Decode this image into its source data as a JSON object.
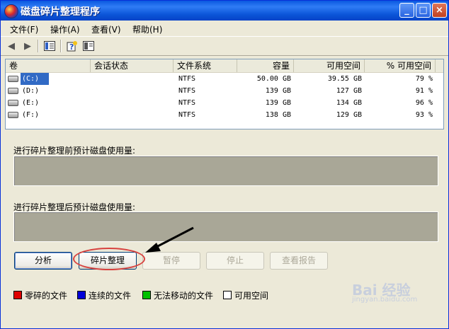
{
  "window": {
    "title": "磁盘碎片整理程序",
    "buttons": {
      "minimize": "_",
      "maximize": "□",
      "close": "×"
    }
  },
  "menu": {
    "items": [
      "文件(F)",
      "操作(A)",
      "查看(V)",
      "帮助(H)"
    ]
  },
  "toolbar": {
    "icons": [
      "back-arrow-icon",
      "forward-arrow-icon",
      "view-icon",
      "help-icon",
      "console-icon"
    ]
  },
  "volumes": {
    "columns": [
      "卷",
      "会话状态",
      "文件系统",
      "容量",
      "可用空间",
      "% 可用空间"
    ],
    "rows": [
      {
        "volume": "(C:)",
        "status": "",
        "fs": "NTFS",
        "capacity": "50.00 GB",
        "free": "39.55 GB",
        "pct": "79 %"
      },
      {
        "volume": "(D:)",
        "status": "",
        "fs": "NTFS",
        "capacity": "139 GB",
        "free": "127 GB",
        "pct": "91 %"
      },
      {
        "volume": "(E:)",
        "status": "",
        "fs": "NTFS",
        "capacity": "139 GB",
        "free": "134 GB",
        "pct": "96 %"
      },
      {
        "volume": "(F:)",
        "status": "",
        "fs": "NTFS",
        "capacity": "138 GB",
        "free": "129 GB",
        "pct": "93 %"
      }
    ]
  },
  "analysis": {
    "before_label": "进行碎片整理前预计磁盘使用量:",
    "after_label": "进行碎片整理后预计磁盘使用量:"
  },
  "actions": {
    "analyze": "分析",
    "defragment": "碎片整理",
    "pause": "暂停",
    "stop": "停止",
    "report": "查看报告"
  },
  "legend": {
    "fragmented": {
      "label": "零碎的文件",
      "color": "#e00000"
    },
    "contiguous": {
      "label": "连续的文件",
      "color": "#0000d8"
    },
    "unmovable": {
      "label": "无法移动的文件",
      "color": "#00c000"
    },
    "free": {
      "label": "可用空间",
      "color": "#ffffff"
    }
  },
  "watermark": {
    "line1": "Bai 经验",
    "line2": "jingyan.baidu.com"
  }
}
